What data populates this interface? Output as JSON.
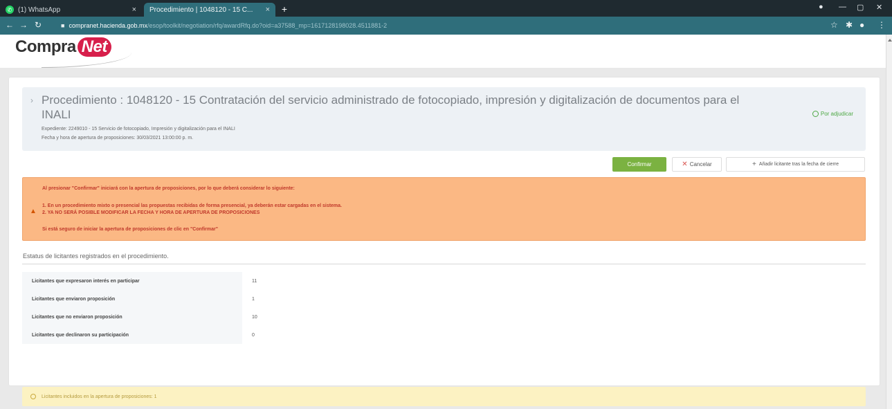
{
  "browser": {
    "tabs": [
      {
        "label": "(1) WhatsApp",
        "active": false
      },
      {
        "label": "Procedimiento | 1048120 - 15 C...",
        "active": true
      }
    ],
    "url_host": "compranet.hacienda.gob.mx",
    "url_path": "/esop/toolkit/negotiation/rfq/awardRfq.do?oid=a37588_mp=1617128198028.4511881-2"
  },
  "brand": {
    "logo_text": "Compra",
    "logo_net": "Net"
  },
  "procedure": {
    "title": "Procedimiento : 1048120 - 15 Contratación del servicio administrado de fotocopiado, impresión y digitalización de documentos para el INALI",
    "expediente": "Expediente: 2249010 - 15 Servicio de fotocopiado, Impresión y digitalización para el INALI",
    "fecha": "Fecha y hora de apertura de proposiciones: 30/03/2021 13:00:00 p. m.",
    "status": "Por adjudicar"
  },
  "actions": {
    "confirm": "Confirmar",
    "cancel": "Cancelar",
    "add": "Añadir licitante tras la fecha de cierre"
  },
  "warning": {
    "line0": "Al presionar \"Confirmar\" iniciará con la apertura de proposiciones, por lo que deberá considerar lo siguiente:",
    "line1": "1. En un procedimiento mixto o presencial las propuestas recibidas de forma presencial, ya deberán estar cargadas en el sistema.",
    "line2": "2. YA NO SERÁ POSIBLE MODIFICAR LA FECHA Y HORA DE APERTURA DE PROPOSICIONES",
    "line3": "Si está seguro de iniciar la apertura de proposiciones de clic en \"Confirmar\""
  },
  "stats": {
    "title": "Estatus de licitantes registrados en el procedimiento.",
    "rows": [
      {
        "label": "Licitantes que expresaron interés en participar",
        "value": "11"
      },
      {
        "label": "Licitantes que enviaron proposición",
        "value": "1"
      },
      {
        "label": "Licitantes que no enviaron proposición",
        "value": "10"
      },
      {
        "label": "Licitantes que declinaron su participación",
        "value": "0"
      }
    ]
  },
  "info": {
    "text": "Licitantes incluidos en la apertura de proposiciones: 1"
  }
}
